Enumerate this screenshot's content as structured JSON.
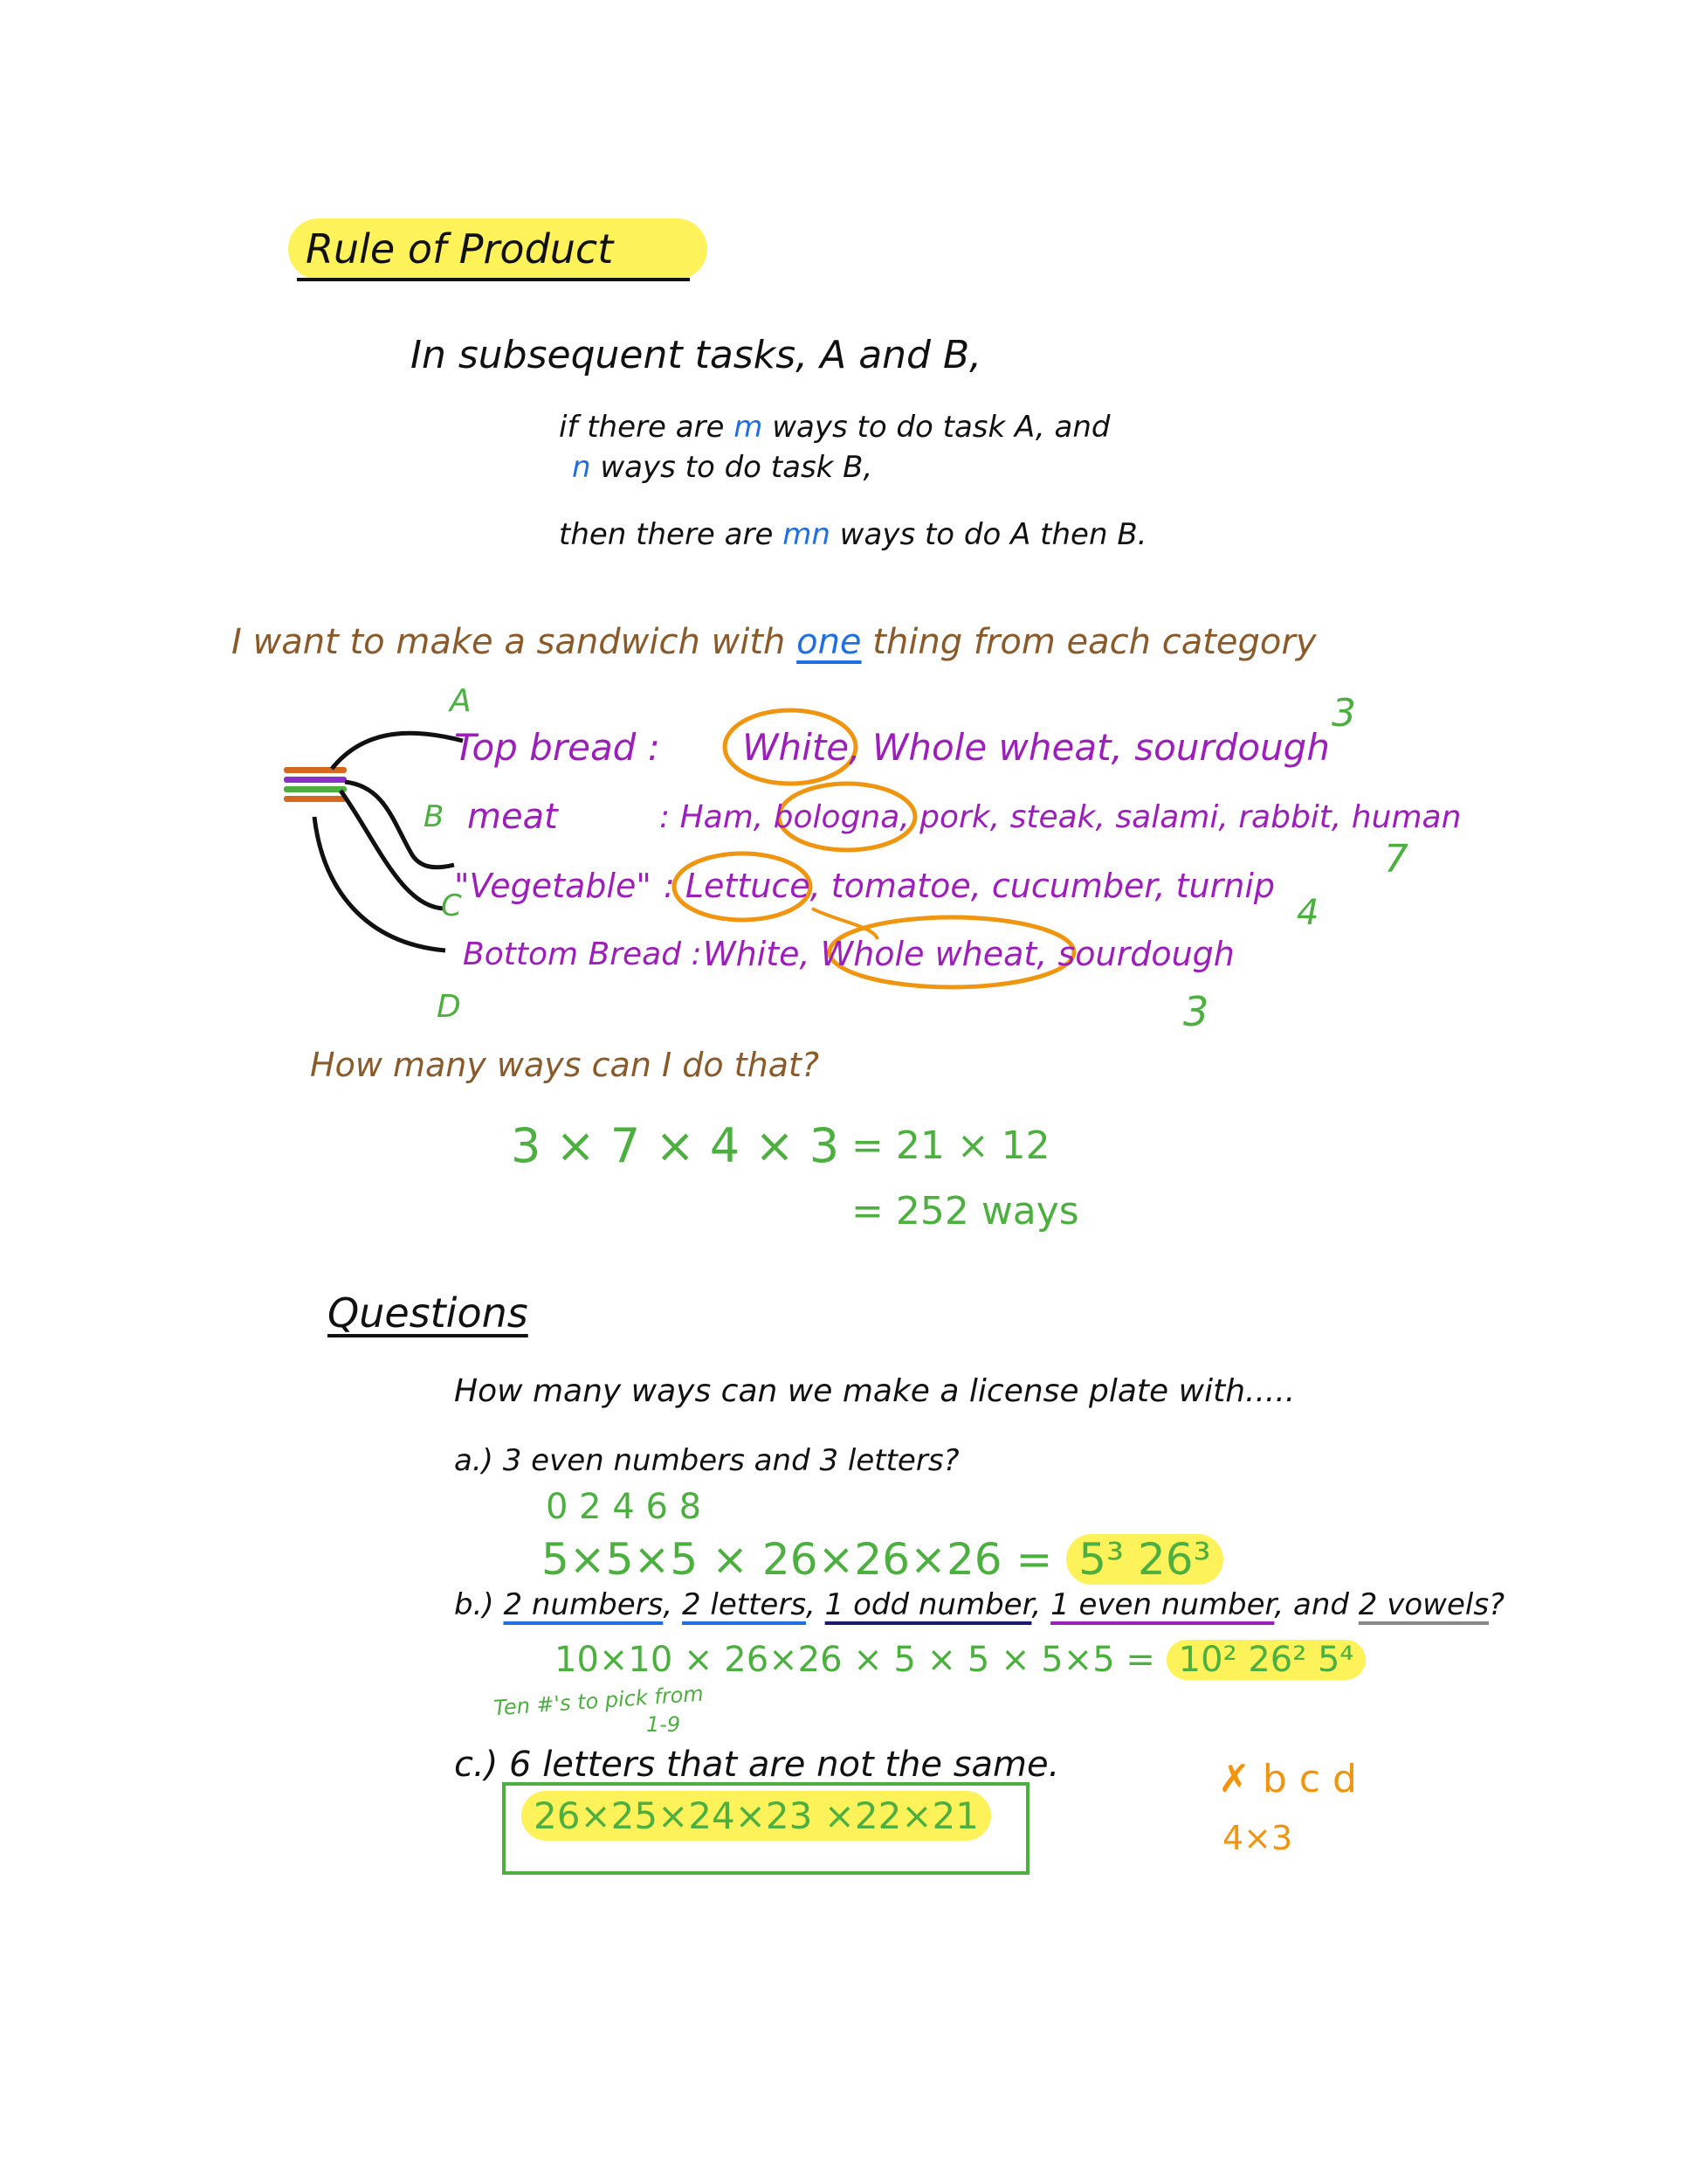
{
  "title": "Rule of Product",
  "rule": {
    "intro": "In subsequent tasks, A and B,",
    "line1_pre": "if there are ",
    "line1_var": "m",
    "line1_post": " ways to do task A, and",
    "line2_var": "n",
    "line2_post": " ways to do task B,",
    "line3_pre": "then there are ",
    "line3_var": "mn",
    "line3_post": " ways to do A then B."
  },
  "sandwich": {
    "intro_pre": "I want to make a sandwich with ",
    "intro_emph": "one",
    "intro_post": " thing from each category",
    "categories": [
      {
        "letter": "A",
        "name": "Top bread :",
        "items": "White, Whole wheat, sourdough",
        "count": "3"
      },
      {
        "letter": "B",
        "name": "meat",
        "items": ": Ham, bologna, pork, steak, salami, rabbit, human",
        "count": "7"
      },
      {
        "letter": "C",
        "name": "\"Vegetable\"",
        "items": ": Lettuce, tomatoe, cucumber, turnip",
        "count": "4"
      },
      {
        "letter": "D",
        "name": "Bottom Bread :",
        "items": "White, Whole wheat, sourdough",
        "count": "3"
      }
    ],
    "question": "How many ways can I do that?",
    "calc1_left": "3 × 7 × 4 × 3",
    "calc1_right": "=  21 × 12",
    "calc2": "=  252 ways"
  },
  "questions": {
    "heading": "Questions",
    "intro": "How many ways can we make a license plate with.....",
    "a": {
      "label": "a.) 3 even numbers and 3 letters?",
      "hint": "0 2 4 6 8",
      "work": "5×5×5 × 26×26×26 = ",
      "answer": "5³ 26³"
    },
    "b": {
      "label_pre": "b.) ",
      "p1": "2 numbers",
      "p2": "2 letters",
      "p3": "1 odd number",
      "p4": "1 even number",
      "mid": ", and ",
      "p5": "2 vowels",
      "end": "?",
      "work": "10×10 × 26×26 × 5 × 5 × 5×5 = ",
      "answer": "10² 26² 5⁴",
      "note1": "Ten #'s to pick from",
      "note2": "1-9"
    },
    "c": {
      "label": "c.) 6 letters that are not the same.",
      "answer": "26×25×24×23 ×22×21",
      "side1": "✗ b c d",
      "side2": "4×3"
    }
  },
  "colors": {
    "black": "#111111",
    "brown": "#8a5a2b",
    "purple": "#9b1fb8",
    "green": "#4caf3f",
    "blue": "#1f6fe0",
    "orange": "#f0950f",
    "highlight": "#fdf25a"
  }
}
